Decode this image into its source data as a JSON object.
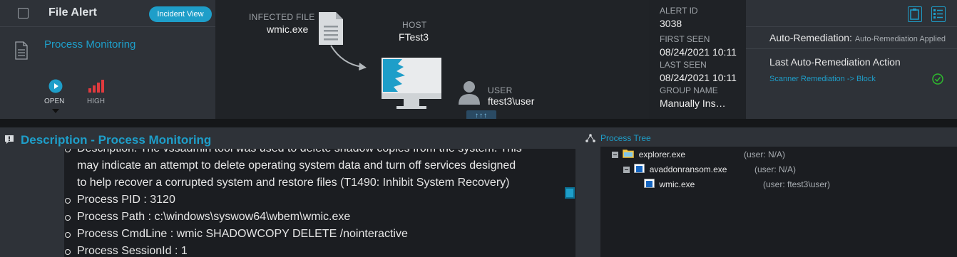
{
  "header": {
    "title": "File Alert",
    "incident_view_label": "Incident View",
    "process_monitoring_label": "Process Monitoring",
    "status_label": "OPEN",
    "severity_label": "HIGH"
  },
  "center": {
    "infected_file_label": "INFECTED FILE",
    "infected_file_value": "wmic.exe",
    "host_label": "HOST",
    "host_value": "FTest3",
    "user_label": "USER",
    "user_value": "ftest3\\user",
    "expand_label": "↑↑↑"
  },
  "meta": {
    "alert_id_label": "ALERT ID",
    "alert_id_value": "3038",
    "first_seen_label": "FIRST SEEN",
    "first_seen_value": "08/24/2021 10:11",
    "last_seen_label": "LAST SEEN",
    "last_seen_value": "08/24/2021 10:11",
    "group_name_label": "GROUP NAME",
    "group_name_value": "Manually Ins…"
  },
  "right": {
    "auto_remediation_label": "Auto-Remediation:",
    "auto_remediation_value": "Auto-Remediation Applied",
    "last_action_label": "Last Auto-Remediation Action",
    "scanner_link": "Scanner Remediation -> Block"
  },
  "description": {
    "title": "Description - Process Monitoring",
    "line_top": "Description: The vssadmin tool was used to delete shadow copies from the system. This",
    "line_2": "may indicate an attempt to delete operating system data and turn off services designed",
    "line_3": "to help recover a corrupted system and restore files (T1490: Inhibit System Recovery)",
    "items": [
      "Process PID : 3120",
      "Process Path : c:\\windows\\syswow64\\wbem\\wmic.exe",
      "Process CmdLine : wmic SHADOWCOPY DELETE /nointeractive",
      "Process SessionId : 1"
    ]
  },
  "process_tree": {
    "title": "Process Tree",
    "nodes": [
      {
        "name": "explorer.exe",
        "user": "(user: N/A)"
      },
      {
        "name": "avaddonransom.exe",
        "user": "(user: N/A)"
      },
      {
        "name": "wmic.exe",
        "user": "(user: ftest3\\user)"
      }
    ]
  },
  "colors": {
    "accent": "#1e9ec9",
    "severity_red": "#e03a3e",
    "success_green": "#2eb82e"
  }
}
